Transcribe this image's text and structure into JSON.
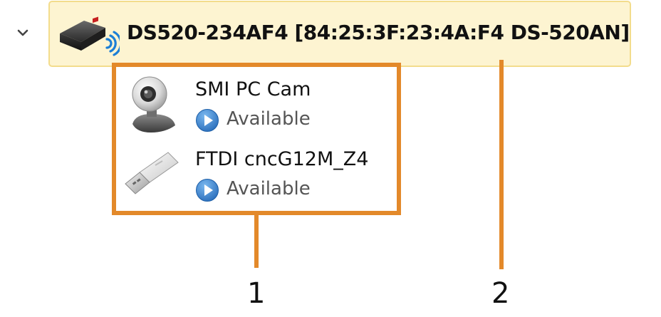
{
  "tree": {
    "device": {
      "label": "DS520-234AF4 [84:25:3F:23:4A:F4 DS-520AN]",
      "icon": "network-device-wireless-icon",
      "expanded": true,
      "children": [
        {
          "title": "SMI PC Cam",
          "icon": "webcam-icon",
          "status": "Available",
          "status_icon": "play-circle-icon"
        },
        {
          "title": "FTDI cncG12M_Z4",
          "icon": "usb-flash-drive-icon",
          "status": "Available",
          "status_icon": "play-circle-icon"
        }
      ]
    }
  },
  "callouts": {
    "items": [
      {
        "number": "1"
      },
      {
        "number": "2"
      }
    ],
    "color": "#e3892a"
  },
  "colors": {
    "selection_bg": "#fdf4d1",
    "selection_border": "#f3dc8c",
    "status_blue": "#2f7fd1"
  }
}
